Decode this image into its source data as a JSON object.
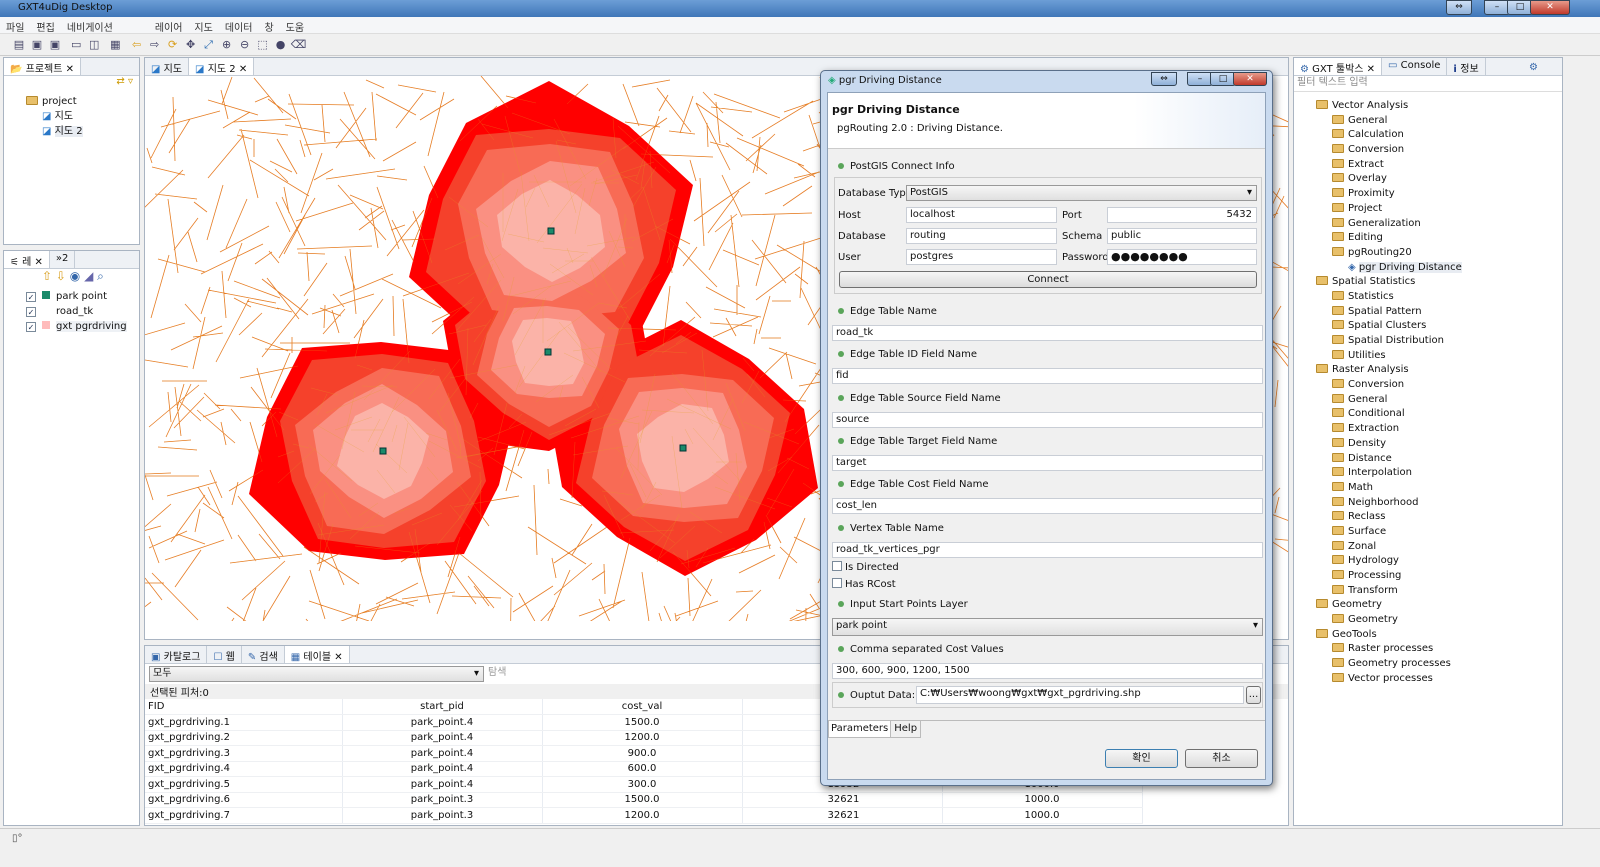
{
  "window": {
    "title": "GXT4uDig Desktop"
  },
  "menu": [
    "파일",
    "편집",
    "네비게이션",
    "레이어",
    "지도",
    "데이터",
    "창",
    "도움"
  ],
  "project_panel": {
    "tab": "프로젝트",
    "root": "project",
    "maps": [
      "지도",
      "지도 2"
    ]
  },
  "layers_panel": {
    "tab": "레",
    "tab2": "»2",
    "layers": [
      {
        "name": "park point",
        "checked": true
      },
      {
        "name": "road_tk",
        "checked": true
      },
      {
        "name": "gxt pgrdriving",
        "checked": true
      }
    ]
  },
  "map_tabs": [
    "지도",
    "지도 2"
  ],
  "bottom_panel": {
    "tabs": [
      "카탈로그",
      "웹",
      "검색",
      "테이블"
    ],
    "filter_select": "모두",
    "search_placeholder": "탐색",
    "selected": "선택된 피처:0",
    "columns": [
      "FID",
      "start_pid",
      "cost_val",
      "",
      ""
    ],
    "rows": [
      [
        "gxt_pgrdriving.1",
        "park_point.4",
        "1500.0",
        "",
        ""
      ],
      [
        "gxt_pgrdriving.2",
        "park_point.4",
        "1200.0",
        "",
        ""
      ],
      [
        "gxt_pgrdriving.3",
        "park_point.4",
        "900.0",
        "",
        ""
      ],
      [
        "gxt_pgrdriving.4",
        "park_point.4",
        "600.0",
        "",
        ""
      ],
      [
        "gxt_pgrdriving.5",
        "park_point.4",
        "300.0",
        "13952",
        "1000.0"
      ],
      [
        "gxt_pgrdriving.6",
        "park_point.3",
        "1500.0",
        "32621",
        "1000.0"
      ],
      [
        "gxt_pgrdriving.7",
        "park_point.3",
        "1200.0",
        "32621",
        "1000.0"
      ]
    ]
  },
  "toolbox": {
    "tabs": [
      "GXT 툴박스",
      "Console",
      "정보"
    ],
    "filter_placeholder": "필터 텍스트 입력",
    "tree": [
      {
        "label": "Vector Analysis",
        "level": 0
      },
      {
        "label": "General",
        "level": 1
      },
      {
        "label": "Calculation",
        "level": 1
      },
      {
        "label": "Conversion",
        "level": 1
      },
      {
        "label": "Extract",
        "level": 1
      },
      {
        "label": "Overlay",
        "level": 1
      },
      {
        "label": "Proximity",
        "level": 1
      },
      {
        "label": "Project",
        "level": 1
      },
      {
        "label": "Generalization",
        "level": 1
      },
      {
        "label": "Editing",
        "level": 1
      },
      {
        "label": "pgRouting20",
        "level": 1
      },
      {
        "label": "pgr Driving Distance",
        "level": 2,
        "selected": true
      },
      {
        "label": "Spatial Statistics",
        "level": 0
      },
      {
        "label": "Statistics",
        "level": 1
      },
      {
        "label": "Spatial Pattern",
        "level": 1
      },
      {
        "label": "Spatial Clusters",
        "level": 1
      },
      {
        "label": "Spatial Distribution",
        "level": 1
      },
      {
        "label": "Utilities",
        "level": 1
      },
      {
        "label": "Raster Analysis",
        "level": 0
      },
      {
        "label": "Conversion",
        "level": 1
      },
      {
        "label": "General",
        "level": 1
      },
      {
        "label": "Conditional",
        "level": 1
      },
      {
        "label": "Extraction",
        "level": 1
      },
      {
        "label": "Density",
        "level": 1
      },
      {
        "label": "Distance",
        "level": 1
      },
      {
        "label": "Interpolation",
        "level": 1
      },
      {
        "label": "Math",
        "level": 1
      },
      {
        "label": "Neighborhood",
        "level": 1
      },
      {
        "label": "Reclass",
        "level": 1
      },
      {
        "label": "Surface",
        "level": 1
      },
      {
        "label": "Zonal",
        "level": 1
      },
      {
        "label": "Hydrology",
        "level": 1
      },
      {
        "label": "Processing",
        "level": 1
      },
      {
        "label": "Transform",
        "level": 1
      },
      {
        "label": "Geometry",
        "level": 0
      },
      {
        "label": "Geometry",
        "level": 1
      },
      {
        "label": "GeoTools",
        "level": 0
      },
      {
        "label": "Raster processes",
        "level": 1
      },
      {
        "label": "Geometry processes",
        "level": 1
      },
      {
        "label": "Vector processes",
        "level": 1
      }
    ]
  },
  "dialog": {
    "title": "pgr Driving Distance",
    "heading": "pgr Driving Distance",
    "subtitle": "pgRouting 2.0 : Driving Distance.",
    "postgis_section": "PostGIS Connect Info",
    "db_type_label": "Database Type",
    "db_type": "PostGIS",
    "host_label": "Host",
    "host": "localhost",
    "port_label": "Port",
    "port": "5432",
    "database_label": "Database",
    "database": "routing",
    "schema_label": "Schema",
    "schema": "public",
    "user_label": "User",
    "user": "postgres",
    "password_label": "Password",
    "password": "●●●●●●●●",
    "connect": "Connect",
    "edge_table_label": "Edge Table Name",
    "edge_table": "road_tk",
    "edge_id_label": "Edge Table ID Field Name",
    "edge_id": "fid",
    "edge_source_label": "Edge Table Source Field Name",
    "edge_source": "source",
    "edge_target_label": "Edge Table Target Field Name",
    "edge_target": "target",
    "edge_cost_label": "Edge Table Cost Field Name",
    "edge_cost": "cost_len",
    "vertex_table_label": "Vertex Table Name",
    "vertex_table": "road_tk_vertices_pgr",
    "is_directed": "Is Directed",
    "has_rcost": "Has RCost",
    "start_layer_label": "Input Start Points Layer",
    "start_layer": "park point",
    "cost_values_label": "Comma separated Cost Values",
    "cost_values": "300, 600, 900, 1200, 1500",
    "output_label": "Ouptut Data:",
    "output": "C:₩Users₩woong₩gxt₩gxt_pgrdriving.shp",
    "browse": "...",
    "tabs": [
      "Parameters",
      "Help"
    ],
    "ok": "확인",
    "cancel": "취소"
  },
  "colors": {
    "road": "#e8752a",
    "iso": [
      "#ff0000",
      "#f5412b",
      "#f86b55",
      "#fa9082",
      "#fbb3a8"
    ],
    "point": "#1a8a6a"
  }
}
